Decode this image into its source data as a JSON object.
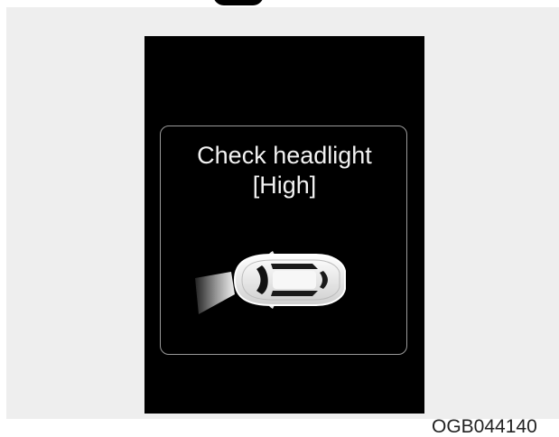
{
  "cluster": {
    "message_line1": "Check headlight",
    "message_line2": "[High]",
    "icon": "car-headlight-warning-icon"
  },
  "figure_code": "OGB044140",
  "colors": {
    "screen_bg": "#000000",
    "panel_bg": "#eeeeee",
    "text": "#f2f2f2",
    "frame": "#9a9a9a"
  }
}
